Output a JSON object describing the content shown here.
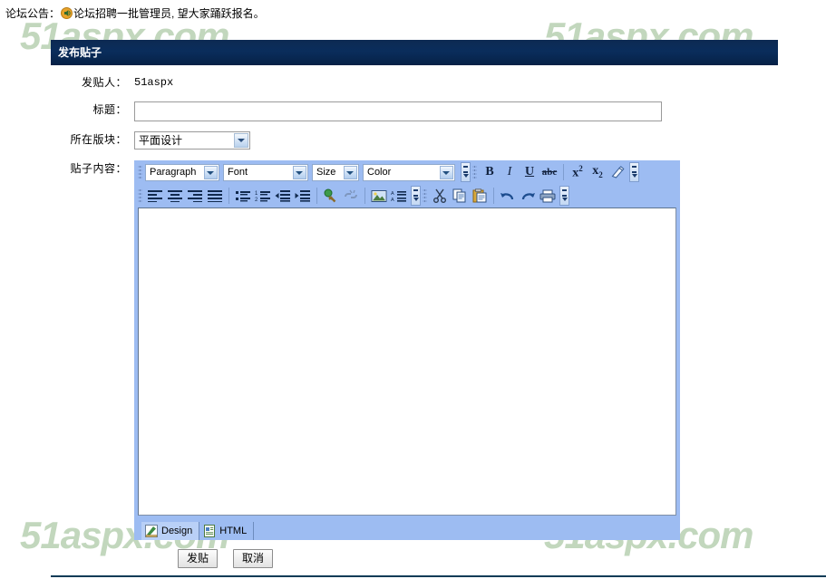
{
  "announcement": {
    "label": "论坛公告：",
    "icon": "speaker-icon",
    "text": "论坛招聘一批管理员, 望大家踊跃报名。"
  },
  "watermark": {
    "text": "51aspx.com",
    "color": "#7aa86f"
  },
  "panel": {
    "header_title": "发布贴子",
    "header_bg": "#0a2d5c"
  },
  "form": {
    "poster": {
      "label": "发贴人：",
      "value": "51aspx"
    },
    "title": {
      "label": "标题：",
      "value": "",
      "placeholder": ""
    },
    "board": {
      "label": "所在版块：",
      "value": "平面设计",
      "options": [
        "平面设计"
      ]
    },
    "content": {
      "label": "贴子内容："
    }
  },
  "editor": {
    "toolbar_row1": {
      "dropdowns": [
        {
          "name": "paragraph-style-select",
          "label": "Paragraph"
        },
        {
          "name": "font-family-select",
          "label": "Font"
        },
        {
          "name": "font-size-select",
          "label": "Size"
        },
        {
          "name": "font-color-select",
          "label": "Color"
        }
      ],
      "buttons": [
        {
          "name": "bold-button",
          "icon": "bold-icon",
          "glyph": "B"
        },
        {
          "name": "italic-button",
          "icon": "italic-icon",
          "glyph": "I"
        },
        {
          "name": "underline-button",
          "icon": "underline-icon",
          "glyph": "U"
        },
        {
          "name": "strikethrough-button",
          "icon": "strikethrough-icon",
          "glyph": "abc"
        },
        {
          "name": "superscript-button",
          "icon": "superscript-icon",
          "glyph": "x²"
        },
        {
          "name": "subscript-button",
          "icon": "subscript-icon",
          "glyph": "x₂"
        },
        {
          "name": "remove-format-button",
          "icon": "eraser-icon",
          "glyph": ""
        }
      ]
    },
    "toolbar_row2": {
      "buttons": [
        {
          "name": "align-left-button",
          "icon": "align-left-icon"
        },
        {
          "name": "align-center-button",
          "icon": "align-center-icon"
        },
        {
          "name": "align-right-button",
          "icon": "align-right-icon"
        },
        {
          "name": "align-justify-button",
          "icon": "align-justify-icon"
        },
        {
          "name": "bulleted-list-button",
          "icon": "bulleted-list-icon"
        },
        {
          "name": "numbered-list-button",
          "icon": "numbered-list-icon"
        },
        {
          "name": "outdent-button",
          "icon": "outdent-icon"
        },
        {
          "name": "indent-button",
          "icon": "indent-icon"
        },
        {
          "name": "insert-link-button",
          "icon": "link-icon"
        },
        {
          "name": "remove-link-button",
          "icon": "unlink-icon"
        },
        {
          "name": "insert-image-button",
          "icon": "image-icon"
        },
        {
          "name": "insert-form-button",
          "icon": "form-icon"
        },
        {
          "name": "cut-button",
          "icon": "scissors-icon"
        },
        {
          "name": "copy-button",
          "icon": "copy-icon"
        },
        {
          "name": "paste-button",
          "icon": "paste-icon"
        },
        {
          "name": "undo-button",
          "icon": "undo-icon"
        },
        {
          "name": "redo-button",
          "icon": "redo-icon"
        },
        {
          "name": "print-button",
          "icon": "printer-icon"
        }
      ]
    },
    "content_value": "",
    "tabs": [
      {
        "name": "tab-design",
        "label": "Design",
        "icon": "design-icon",
        "active": true
      },
      {
        "name": "tab-html",
        "label": "HTML",
        "icon": "html-icon",
        "active": false
      }
    ],
    "toolbar_bg": "#9dbcf2"
  },
  "actions": {
    "submit_label": "发贴",
    "cancel_label": "取消"
  }
}
